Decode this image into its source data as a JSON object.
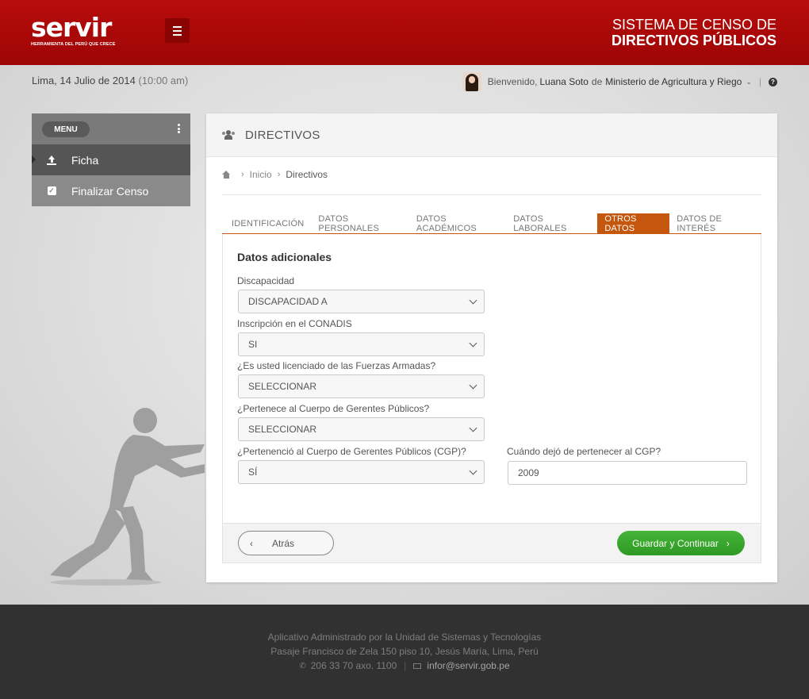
{
  "header": {
    "logo_text": "servir",
    "logo_tagline": "HERRAMIENTA DEL PERÚ QUE CRECE",
    "title_line1": "SISTEMA DE CENSO  DE",
    "title_line2": "DIRECTIVOS PÚBLICOS"
  },
  "infobar": {
    "date": "Lima, 14 Julio de 2014",
    "time": "(10:00 am)",
    "welcome": "Bienvenido,",
    "user_name": "Luana Soto",
    "de": "de",
    "organization": "Ministerio de Agricultura y Riego",
    "help_icon": "?"
  },
  "sidebar": {
    "menu_label": "MENU",
    "items": [
      {
        "label": "Ficha",
        "icon": "upload-icon"
      },
      {
        "label": "Finalizar Censo",
        "icon": "checkbox-icon"
      }
    ]
  },
  "panel": {
    "title": "DIRECTIVOS",
    "breadcrumb": {
      "home": "Inicio",
      "current": "Directivos"
    },
    "tabs": [
      "IDENTIFICACIÓN",
      "DATOS PERSONALES",
      "DATOS ACADÉMICOS",
      "DATOS LABORALES",
      "OTROS DATOS",
      "DATOS DE INTERÉS"
    ],
    "active_tab": "OTROS DATOS",
    "form": {
      "title": "Datos adicionales",
      "discapacidad_label": "Discapacidad",
      "discapacidad_value": "DISCAPACIDAD A",
      "conadis_label": "Inscripción en el CONADIS",
      "conadis_value": "SI",
      "ffaa_label": "¿Es usted licenciado de las Fuerzas Armadas?",
      "ffaa_value": "SELECCIONAR",
      "cgp_label": "¿Pertenece al Cuerpo de Gerentes Públicos?",
      "cgp_value": "SELECCIONAR",
      "cgp_past_label": "¿Pertenenció al Cuerpo de Gerentes Públicos (CGP)?",
      "cgp_past_value": "SÍ",
      "cgp_left_label": "Cuándo dejó de pertenecer al CGP?",
      "cgp_left_value": "2009",
      "back_label": "Atrás",
      "next_label": "Guardar y Continuar"
    }
  },
  "footer": {
    "line1": "Aplicativo Administrado por la Unidad de Sistemas y Tecnologías",
    "line2": "Pasaje Francisco de Zela 150 piso 10, Jesús María, Lima, Perú",
    "phone": "206 33 70 axo. 1100",
    "email": "infor@servir.gob.pe"
  },
  "colors": {
    "header_red": "#a80808",
    "tab_active": "#c4560d",
    "next_button_green": "#3aa82e",
    "footer_bg": "#313131"
  }
}
